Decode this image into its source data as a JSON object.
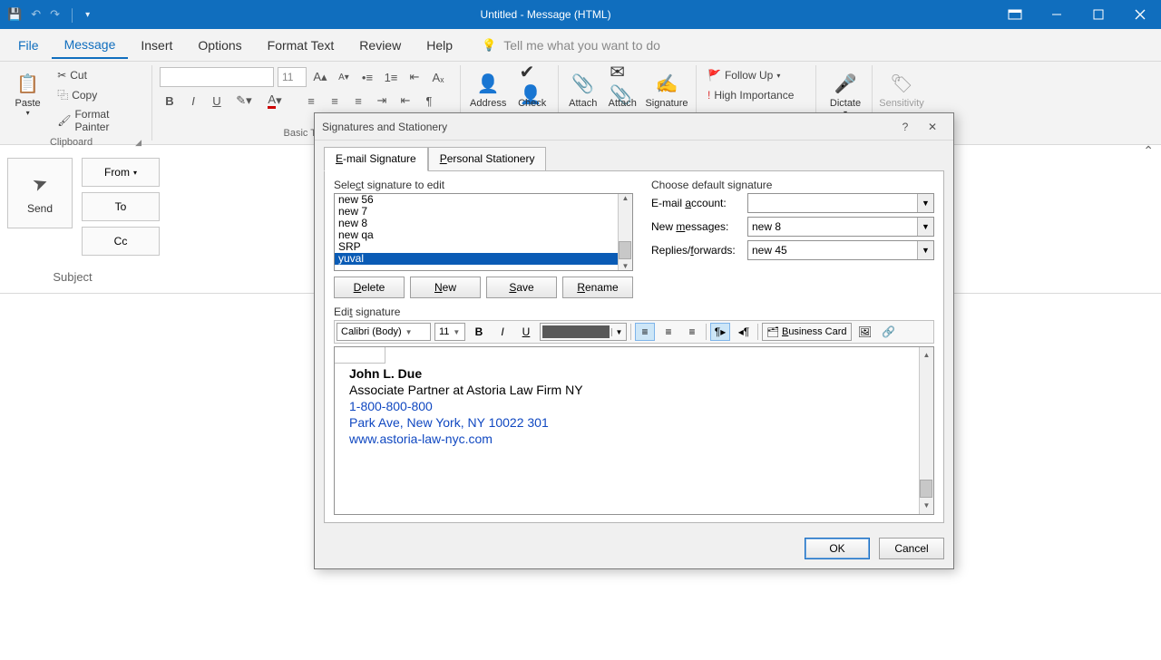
{
  "window": {
    "title": "Untitled  -  Message (HTML)"
  },
  "ribbon_tabs": {
    "file": "File",
    "message": "Message",
    "insert": "Insert",
    "options": "Options",
    "format": "Format Text",
    "review": "Review",
    "help": "Help",
    "tellme": "Tell me what you want to do"
  },
  "ribbon": {
    "paste": "Paste",
    "cut": "Cut",
    "copy": "Copy",
    "format_painter": "Format Painter",
    "clipboard": "Clipboard",
    "basic_text": "Basic Text",
    "address": "Address",
    "check": "Check",
    "attach": "Attach",
    "attach2": "Attach",
    "signature": "Signature",
    "followup": "Follow Up",
    "high_importance": "High Importance",
    "dictate": "Dictate",
    "sensitivity": "Sensitivity",
    "font_size": "11"
  },
  "compose": {
    "send": "Send",
    "from": "From",
    "to": "To",
    "cc": "Cc",
    "subject": "Subject"
  },
  "dialog": {
    "title": "Signatures and Stationery",
    "tab_email": "E-mail Signature",
    "tab_personal": "Personal Stationery",
    "select_label": "Select signature to edit",
    "choose_label": "Choose default signature",
    "list": {
      "i0": "new 56",
      "i1": "new 7",
      "i2": "new 8",
      "i3": "new qa",
      "i4": "SRP",
      "i5": "yuval"
    },
    "btn_delete": "Delete",
    "btn_new": "New",
    "btn_save": "Save",
    "btn_rename": "Rename",
    "account_label": "E-mail account:",
    "newmsg_label": "New messages:",
    "reply_label": "Replies/forwards:",
    "newmsg_val": "new 8",
    "reply_val": "new 45",
    "edit_label": "Edit signature",
    "font_name": "Calibri (Body)",
    "font_size": "11",
    "bcard": "Business Card",
    "sig": {
      "name": "John L. Due",
      "title": "Associate Partner at Astoria Law Firm NY",
      "phone": "1-800-800-800",
      "addr": "Park Ave, New York, NY 10022 301",
      "web": "www.astoria-law-nyc.com"
    },
    "ok": "OK",
    "cancel": "Cancel"
  }
}
